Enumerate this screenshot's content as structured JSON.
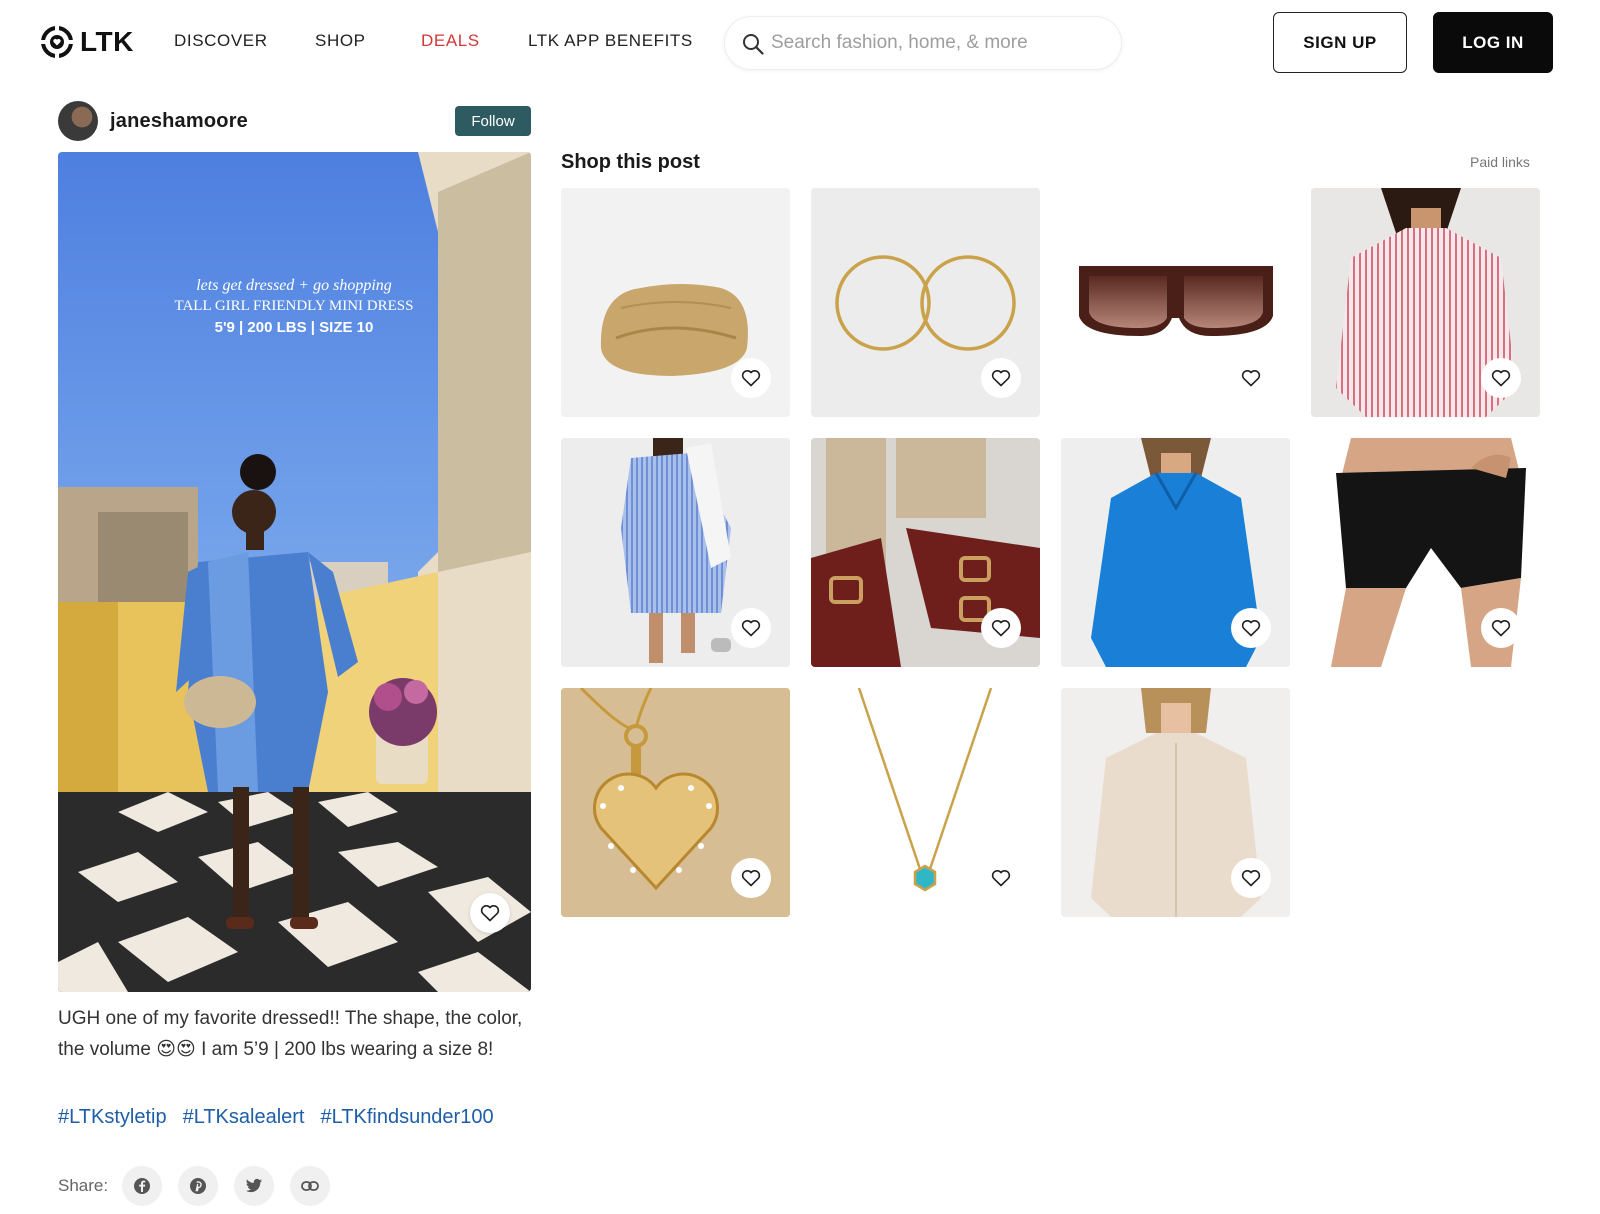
{
  "header": {
    "logo_text": "LTK",
    "nav": [
      {
        "label": "DISCOVER"
      },
      {
        "label": "SHOP"
      },
      {
        "label": "DEALS"
      },
      {
        "label": "LTK APP BENEFITS"
      }
    ],
    "search_placeholder": "Search fashion, home, & more",
    "signup_label": "SIGN UP",
    "login_label": "LOG IN"
  },
  "post": {
    "creator_name": "janeshamoore",
    "follow_label": "Follow",
    "image_overlay": {
      "line1": "lets get dressed + go shopping",
      "line2": "TALL GIRL FRIENDLY MINI DRESS",
      "line3": "5'9 | 200 LBS | SIZE 10"
    },
    "caption": "UGH one of my favorite dressed!! The shape, the color, the volume 😍😍 I am 5’9 | 200 lbs wearing a size 8!",
    "hashtags": [
      "#LTKstyletip",
      "#LTKsalealert",
      "#LTKfindsunder100"
    ],
    "share_label": "Share:"
  },
  "shop": {
    "title": "Shop this post",
    "paid_links_label": "Paid links",
    "products": [
      {
        "item": "woven clutch bag"
      },
      {
        "item": "gold hoop earrings"
      },
      {
        "item": "brown shield sunglasses"
      },
      {
        "item": "pink striped shirt dress"
      },
      {
        "item": "blue striped shirt dress"
      },
      {
        "item": "burgundy buckle sandals"
      },
      {
        "item": "blue oversized shirt dress"
      },
      {
        "item": "black biker shorts"
      },
      {
        "item": "gold heart pendant"
      },
      {
        "item": "gold necklace with turquoise charm"
      },
      {
        "item": "cream oversized shirt dress"
      }
    ]
  },
  "colors": {
    "deals": "#d2383b",
    "follow_bg": "#2e5b61",
    "hashtag": "#1e5ea8",
    "login_bg": "#0a0a0a"
  }
}
